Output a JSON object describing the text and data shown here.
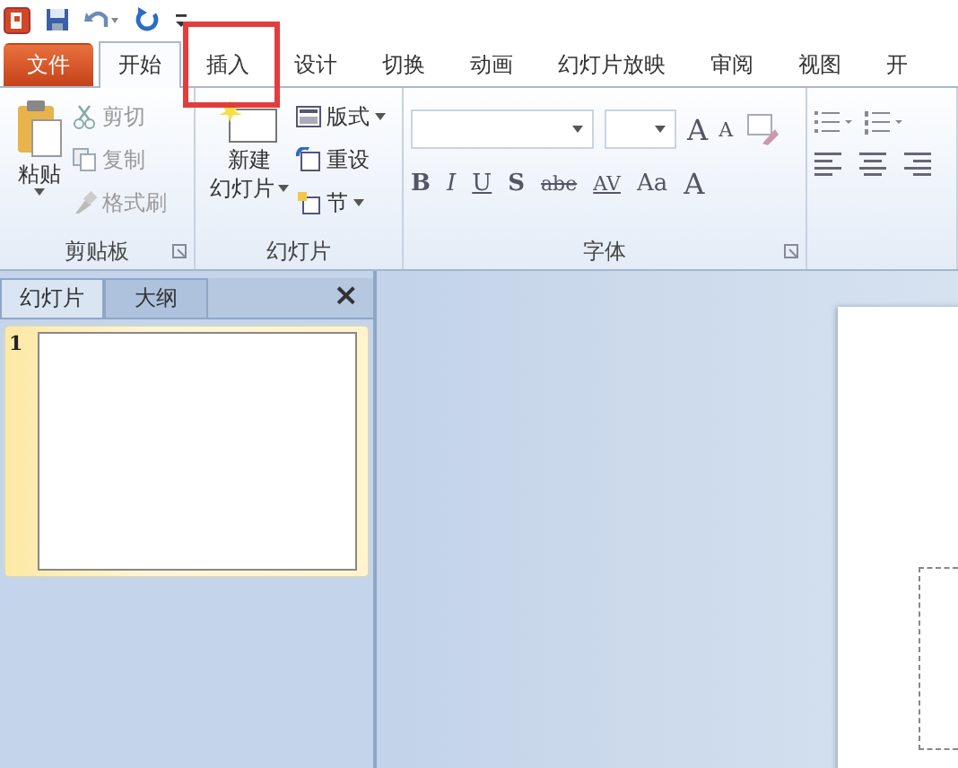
{
  "ribbon_tabs": [
    {
      "label": "文件",
      "kind": "file",
      "selected": false,
      "highlighted": false
    },
    {
      "label": "开始",
      "kind": "tab",
      "selected": true,
      "highlighted": false
    },
    {
      "label": "插入",
      "kind": "tab",
      "selected": false,
      "highlighted": true
    },
    {
      "label": "设计",
      "kind": "tab",
      "selected": false,
      "highlighted": false
    },
    {
      "label": "切换",
      "kind": "tab",
      "selected": false,
      "highlighted": false
    },
    {
      "label": "动画",
      "kind": "tab",
      "selected": false,
      "highlighted": false
    },
    {
      "label": "幻灯片放映",
      "kind": "tab",
      "selected": false,
      "highlighted": false
    },
    {
      "label": "审阅",
      "kind": "tab",
      "selected": false,
      "highlighted": false
    },
    {
      "label": "视图",
      "kind": "tab",
      "selected": false,
      "highlighted": false
    },
    {
      "label": "开",
      "kind": "tab",
      "selected": false,
      "highlighted": false
    }
  ],
  "clipboard": {
    "label": "剪贴板",
    "paste": "粘贴",
    "cut": "剪切",
    "copy": "复制",
    "format_painter": "格式刷"
  },
  "slides": {
    "label": "幻灯片",
    "new_slide_line1": "新建",
    "new_slide_line2": "幻灯片",
    "layout": "版式",
    "reset": "重设",
    "section": "节"
  },
  "font": {
    "label": "字体",
    "grow": "A",
    "shrink": "A",
    "bold": "B",
    "italic": "I",
    "underline": "U",
    "shadow": "S",
    "strike": "abe",
    "spacing": "AV",
    "case": "Aa",
    "font_color": "A"
  },
  "panel": {
    "tabs": [
      {
        "label": "幻灯片",
        "selected": true
      },
      {
        "label": "大纲",
        "selected": false
      }
    ],
    "close": "×",
    "thumbnails": [
      {
        "number": "1",
        "selected": true
      }
    ]
  }
}
